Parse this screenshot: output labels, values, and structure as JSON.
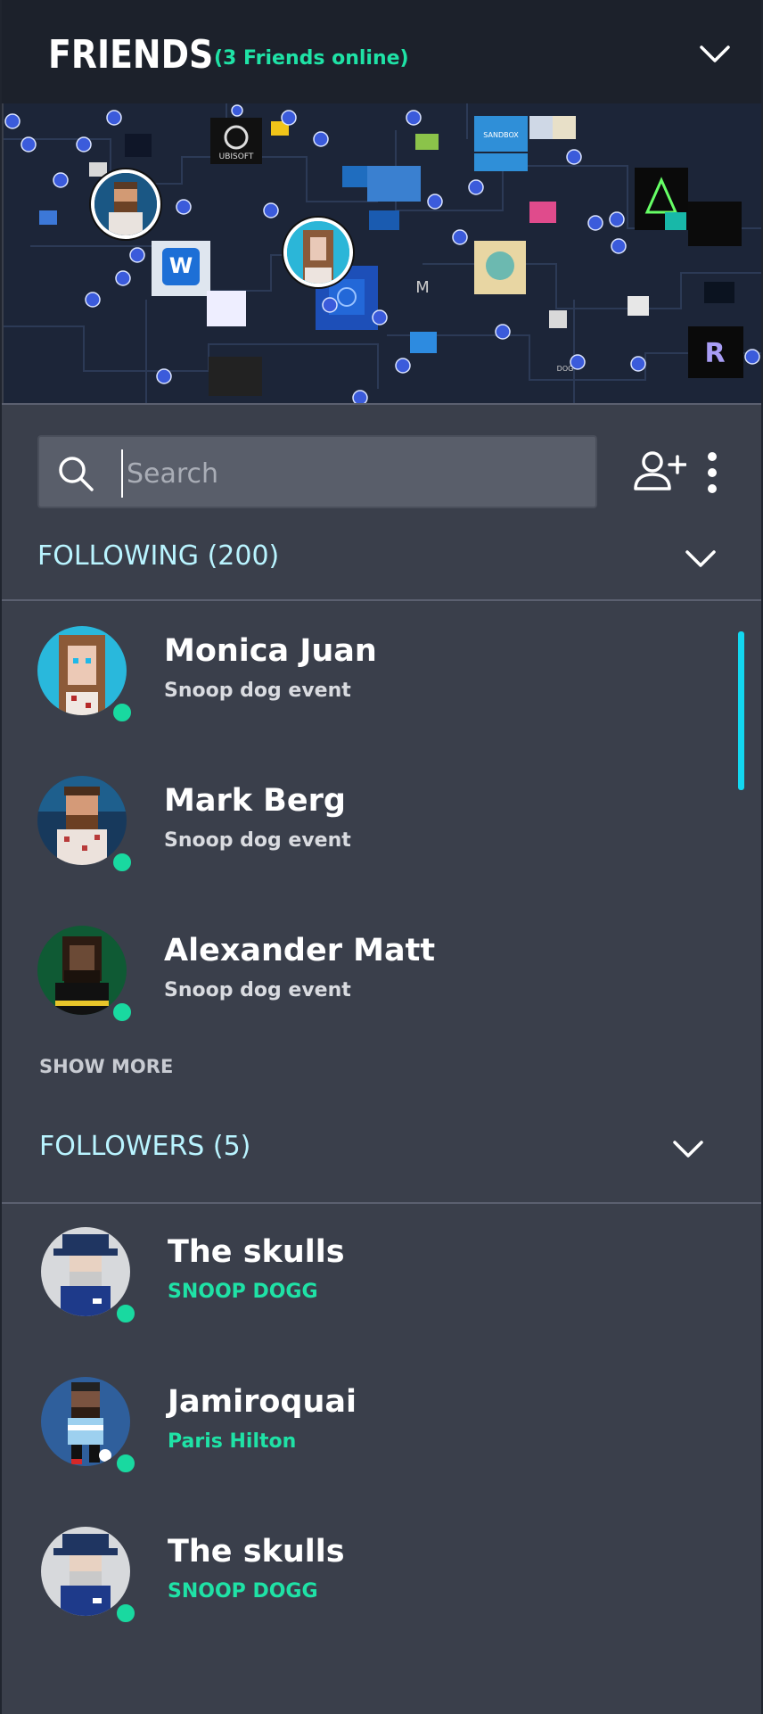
{
  "header": {
    "title": "FRIENDS",
    "online_text": "(3 Friends online)"
  },
  "map": {
    "brand_labels": [
      "UBISOFT",
      "SANDBOX",
      "DOG",
      "M"
    ]
  },
  "search": {
    "placeholder": "Search",
    "value": ""
  },
  "following": {
    "label": "FOLLOWING",
    "count": "(200)",
    "items": [
      {
        "name": "Monica Juan",
        "subtitle": "Snoop dog event"
      },
      {
        "name": "Mark Berg",
        "subtitle": "Snoop dog event"
      },
      {
        "name": "Alexander Matt",
        "subtitle": "Snoop dog event"
      }
    ],
    "show_more": "SHOW MORE"
  },
  "followers": {
    "label": "FOLLOWERS (5)",
    "items": [
      {
        "name": "The skulls",
        "subtitle": "SNOOP DOGG"
      },
      {
        "name": "Jamiroquai",
        "subtitle": "Paris Hilton"
      },
      {
        "name": "The skulls",
        "subtitle": "SNOOP DOGG"
      }
    ]
  },
  "colors": {
    "panel_bg": "#3a3f4b",
    "header_bg": "#1c212b",
    "accent_green": "#1fe2a6",
    "section_label": "#b9f4ff",
    "scrollbar": "#12d7f0",
    "online_dot": "#19d9a0"
  },
  "icons": {
    "header_toggle": "chevron-down-icon",
    "search": "search-icon",
    "add_friend": "add-user-icon",
    "more": "more-vertical-icon"
  }
}
